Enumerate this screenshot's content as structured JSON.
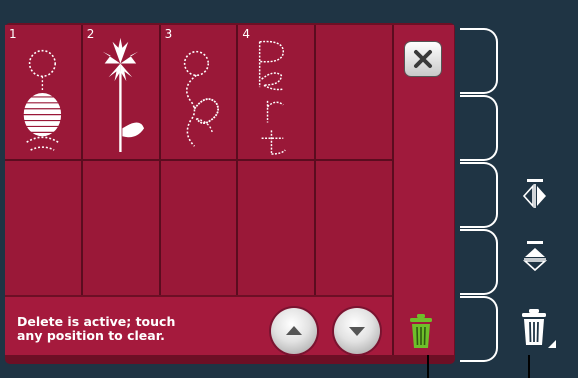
{
  "grid": {
    "slots": [
      {
        "number": "1",
        "design": "circle-satin-motif"
      },
      {
        "number": "2",
        "design": "flower-stem-motif"
      },
      {
        "number": "3",
        "design": "circle-heart-motif"
      },
      {
        "number": "4",
        "design": "pert-text-motif"
      }
    ]
  },
  "status": {
    "message": "Delete is active; touch\nany position to clear."
  },
  "colors": {
    "panel": "#6d0f25",
    "cell": "#9a1838",
    "status_bar": "#a51a3d",
    "background": "#1f3444",
    "trash_green": "#6fbf2a"
  },
  "icons": {
    "close": "close-icon",
    "scroll_up": "arrow-up-icon",
    "scroll_down": "arrow-down-icon",
    "delete_active": "trash-icon",
    "mirror_side": "mirror-side-icon",
    "mirror_end": "mirror-end-icon",
    "delete": "trash-icon"
  }
}
